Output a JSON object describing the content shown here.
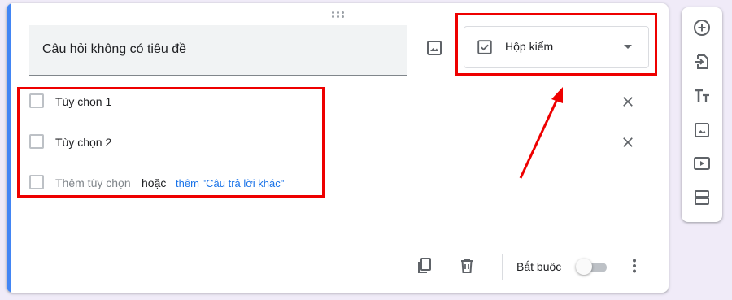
{
  "question": {
    "title": "Câu hỏi không có tiêu đề"
  },
  "question_type": {
    "selected": "Hộp kiểm",
    "icon": "checkbox-checked-icon"
  },
  "options": [
    {
      "label": "Tùy chọn 1"
    },
    {
      "label": "Tùy chọn 2"
    }
  ],
  "add_option": {
    "label": "Thêm tùy chọn",
    "or_text": "hoặc",
    "add_other_label": "thêm \"Câu trả lời khác\""
  },
  "footer": {
    "required_label": "Bắt buộc",
    "required_on": false
  },
  "side_toolbar": {
    "icons": [
      "add-question-icon",
      "import-questions-icon",
      "add-title-icon",
      "add-image-icon",
      "add-video-icon",
      "add-section-icon"
    ]
  },
  "colors": {
    "accent": "#4285f4",
    "highlight": "#e00000",
    "link": "#1a73e8",
    "page_bg": "#f0ebf8"
  }
}
